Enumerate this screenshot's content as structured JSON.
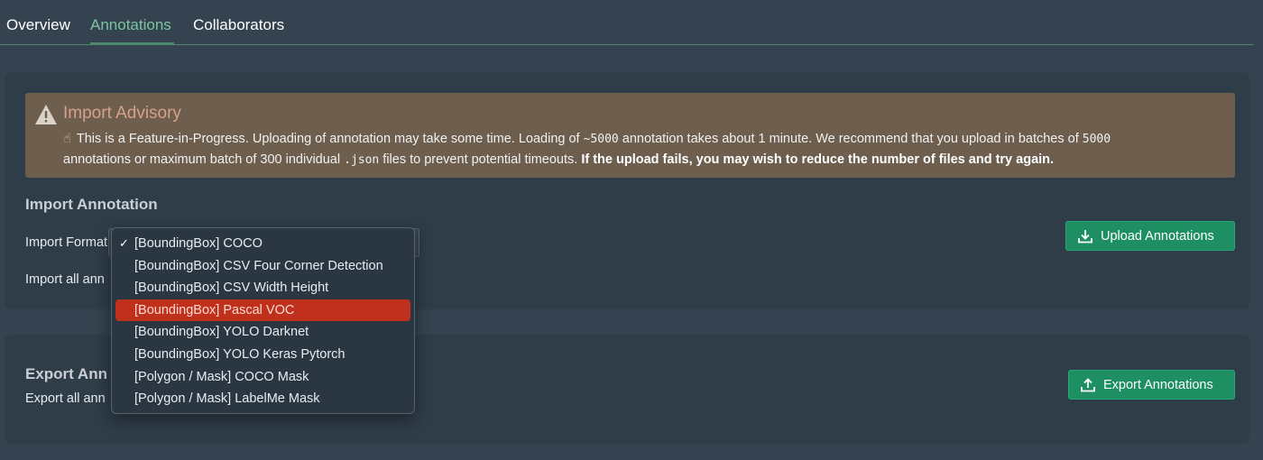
{
  "tabs": [
    {
      "label": "Overview"
    },
    {
      "label": "Annotations"
    },
    {
      "label": "Collaborators"
    }
  ],
  "active_tab": "Annotations",
  "advisory": {
    "icon": "warning-triangle-icon",
    "title": "Import Advisory",
    "hand_icon": "☝",
    "text_1": "This is a Feature-in-Progress. Uploading of annotation may take some time. Loading of ",
    "code_1": "~5000",
    "text_2": " annotation takes about 1 minute. We recommend that you upload in batches of ",
    "code_2": "5000",
    "text_3": " annotations or maximum batch of 300 individual ",
    "code_3": ".json",
    "text_4": " files to prevent potential timeouts. ",
    "bold_text": "If the upload fails, you may wish to reduce the number of files and try again."
  },
  "import_section": {
    "title": "Import Annotation",
    "format_label": "Import Format",
    "import_all_label": "Import all ann",
    "upload_button": "Upload Annotations"
  },
  "export_section": {
    "title": "Export Ann",
    "export_all_label": "Export all ann",
    "export_button": "Export Annotations"
  },
  "format_dropdown": {
    "checked_item": "[BoundingBox] COCO",
    "highlighted_item": "[BoundingBox] Pascal VOC",
    "check_glyph": "✓",
    "options": [
      "[BoundingBox] COCO",
      "[BoundingBox] CSV Four Corner Detection",
      "[BoundingBox] CSV Width Height",
      "[BoundingBox] Pascal VOC",
      "[BoundingBox] YOLO Darknet",
      "[BoundingBox] YOLO Keras Pytorch",
      "[Polygon / Mask] COCO Mask",
      "[Polygon / Mask] LabelMe Mask"
    ]
  },
  "colors": {
    "background": "#34434f",
    "panel": "#2f3d49",
    "advisory": "#6d5e4e",
    "accent_green": "#1e8f62",
    "tab_active": "#7cc4a0",
    "highlight_red": "#c0311d"
  }
}
